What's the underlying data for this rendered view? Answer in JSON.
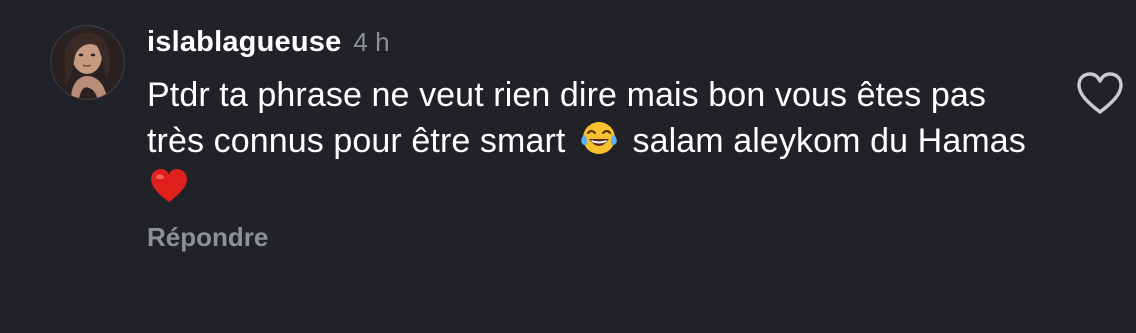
{
  "comment": {
    "username": "islablagueuse",
    "timestamp": "4 h",
    "text_line_parts": {
      "part1": "Ptdr ta phrase ne veut rien dire mais bon vous êtes pas très connus pour être smart",
      "part2": "salam aleykom du Hamas"
    },
    "emojis": [
      "face-with-tears-of-joy",
      "red-heart"
    ],
    "reply_label": "Répondre",
    "like_icon": "heart-outline-icon"
  },
  "colors": {
    "background": "#212228",
    "text_primary": "#ffffff",
    "text_secondary": "#8e9098",
    "heart_red": "#e0201c"
  }
}
